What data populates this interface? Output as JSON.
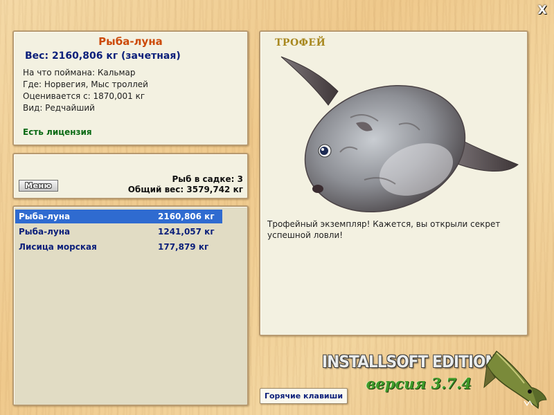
{
  "window": {
    "close_label": "X"
  },
  "fish_info": {
    "title": "Рыба-луна",
    "weight_line": "Вес: 2160,806 кг (зачетная)",
    "bait": "На что поймана: Кальмар",
    "location": "Где: Норвегия, Мыс троллей",
    "valued_from": "Оценивается с: 1870,001 кг",
    "rarity": "Вид: Редчайший",
    "license": "Есть лицензия"
  },
  "keepnet": {
    "menu_label": "Меню",
    "fish_count": "Рыб в садке: 3",
    "total_weight": "Общий вес: 3579,742 кг"
  },
  "catch_list": [
    {
      "name": "Рыба-луна",
      "weight": "2160,806 кг",
      "selected": true
    },
    {
      "name": "Рыба-луна",
      "weight": "1241,057 кг",
      "selected": false
    },
    {
      "name": "Лисица морская",
      "weight": "177,879 кг",
      "selected": false
    }
  ],
  "trophy": {
    "label": "ТРОФЕЙ",
    "text": "Трофейный экземпляр! Кажется, вы открыли секрет успешной ловли!"
  },
  "footer": {
    "hotkeys_label": "Горячие клавиши",
    "brand_name": "INSTALLSOFT EDITION",
    "version": "версия 3.7.4"
  },
  "colors": {
    "title": "#cc4a0a",
    "weight": "#0b1f7a",
    "license": "#0a6a14",
    "selection": "#2f6bd0",
    "trophy_label": "#a8881f"
  }
}
